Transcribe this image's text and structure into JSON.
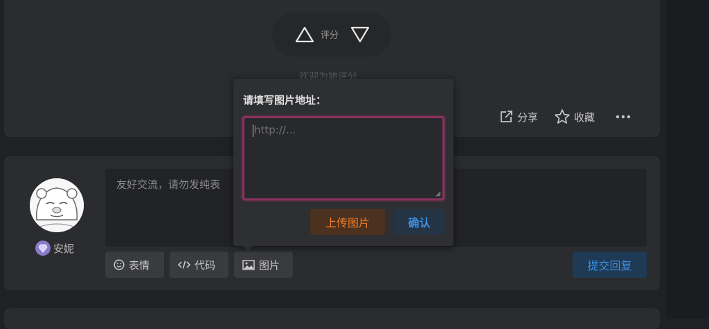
{
  "rating": {
    "label": "评分",
    "upvote_icon": "triangle-up-icon",
    "downvote_icon": "triangle-down-icon"
  },
  "faded_hint": "欢迎为她评分",
  "post_actions": {
    "share_label": "分享",
    "favorite_label": "收藏",
    "more_icon": "more-horizontal-icon"
  },
  "reply": {
    "placeholder": "友好交流，请勿发纯表",
    "user_name": "安妮",
    "badge_icon": "gem-icon",
    "tools": {
      "emoji_label": "表情",
      "code_label": "代码",
      "image_label": "图片"
    },
    "submit_label": "提交回复"
  },
  "image_popover": {
    "title": "请填写图片地址：",
    "url_placeholder": "http://...",
    "upload_label": "上传图片",
    "confirm_label": "确认"
  },
  "colors": {
    "background": "#202124",
    "card": "#2b2c2f",
    "accent_blue": "#3b8fe0",
    "accent_orange": "#ef7d2a",
    "focus_border": "#8a3260"
  }
}
